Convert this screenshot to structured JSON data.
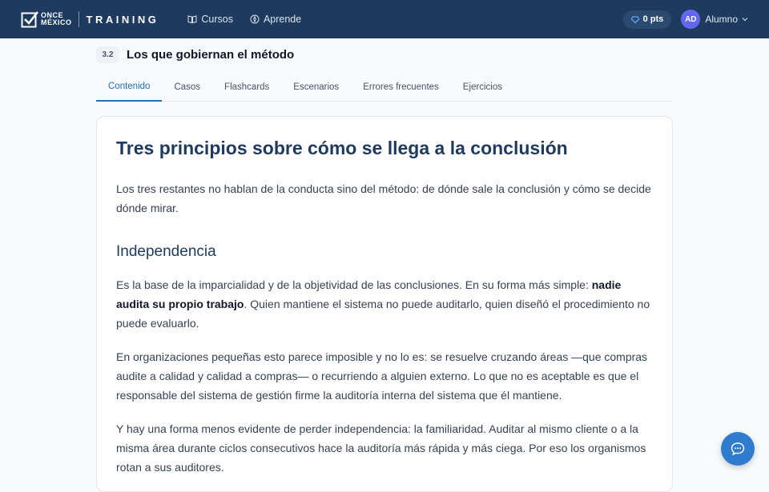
{
  "header": {
    "logo_line1": "ONCE",
    "logo_line2": "MÉXICO",
    "brand": "TRAINING",
    "nav": [
      {
        "label": "Cursos",
        "icon": "book-icon"
      },
      {
        "label": "Aprende",
        "icon": "compass-icon"
      }
    ],
    "points_label": "0 pts",
    "user": {
      "initials": "AD",
      "name": "Alumno"
    }
  },
  "lesson": {
    "number": "3.2",
    "title": "Los que gobiernan el método"
  },
  "tabs": [
    {
      "label": "Contenido",
      "active": true
    },
    {
      "label": "Casos"
    },
    {
      "label": "Flashcards"
    },
    {
      "label": "Escenarios"
    },
    {
      "label": "Errores frecuentes"
    },
    {
      "label": "Ejercicios"
    }
  ],
  "content": {
    "title": "Tres principios sobre cómo se llega a la conclusión",
    "intro": "Los tres restantes no hablan de la conducta sino del método: de dónde sale la conclusión y cómo se decide dónde mirar.",
    "section_title": "Independencia",
    "p1_before": "Es la base de la imparcialidad y de la objetividad de las conclusiones. En su forma más simple: ",
    "p1_bold": "nadie audita su propio trabajo",
    "p1_after": ". Quien mantiene el sistema no puede auditarlo, quien diseñó el procedimiento no puede evaluarlo.",
    "p2": "En organizaciones pequeñas esto parece imposible y no lo es: se resuelve cruzando áreas —que compras audite a calidad y calidad a compras— o recurriendo a alguien externo. Lo que no es aceptable es que el responsable del sistema de gestión firme la auditoría interna del sistema que él mantiene.",
    "p3": "Y hay una forma menos evidente de perder independencia: la familiaridad. Auditar al mismo cliente o a la misma área durante ciclos consecutivos hace la auditoría más rápida y más ciega. Por eso los organismos rotan a sus auditores."
  },
  "colors": {
    "navbar": "#1e3a5f",
    "accent": "#1d6fb8",
    "chat_button": "#2f7ccf",
    "avatar": "#6366f1"
  }
}
